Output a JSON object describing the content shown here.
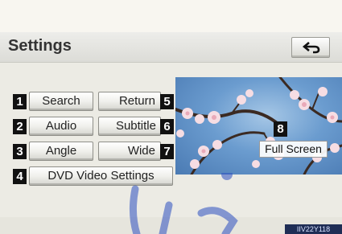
{
  "header": {
    "title": "Settings",
    "back_icon": "return-arrow-icon"
  },
  "menu": {
    "search": {
      "number": "1",
      "label": "Search"
    },
    "audio": {
      "number": "2",
      "label": "Audio"
    },
    "angle": {
      "number": "3",
      "label": "Angle"
    },
    "dvd_settings": {
      "number": "4",
      "label": "DVD Video Settings"
    },
    "return": {
      "number": "5",
      "label": "Return"
    },
    "subtitle": {
      "number": "6",
      "label": "Subtitle"
    },
    "wide": {
      "number": "7",
      "label": "Wide"
    },
    "full_screen": {
      "number": "8",
      "label": "Full Screen"
    }
  },
  "figure_code": "IIV22Y118"
}
